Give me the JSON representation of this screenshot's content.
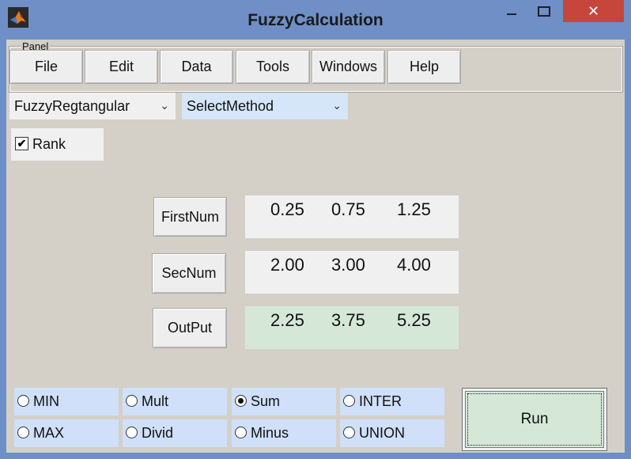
{
  "window": {
    "title": "FuzzyCalculation",
    "close_glyph": "✕"
  },
  "panel": {
    "label": "Panel"
  },
  "menu": [
    {
      "label": "File"
    },
    {
      "label": "Edit"
    },
    {
      "label": "Data"
    },
    {
      "label": "Tools"
    },
    {
      "label": "Windows"
    },
    {
      "label": "Help"
    }
  ],
  "selects": {
    "fuzzy_type": {
      "value": "FuzzyRegtangular",
      "bg": "#f0f0f0"
    },
    "method": {
      "value": "SelectMethod",
      "bg": "#d5e6f8"
    }
  },
  "rank": {
    "label": "Rank",
    "checked": true,
    "glyph": "✔"
  },
  "rows": [
    {
      "button": "FirstNum",
      "values": [
        "0.25",
        "0.75",
        "1.25"
      ]
    },
    {
      "button": "SecNum",
      "values": [
        "2.00",
        "3.00",
        "4.00"
      ]
    },
    {
      "button": "OutPut",
      "values": [
        "2.25",
        "3.75",
        "5.25"
      ]
    }
  ],
  "operations": [
    {
      "label": "MIN",
      "selected": false
    },
    {
      "label": "Mult",
      "selected": false
    },
    {
      "label": "Sum",
      "selected": true
    },
    {
      "label": "INTER",
      "selected": false
    },
    {
      "label": "MAX",
      "selected": false
    },
    {
      "label": "Divid",
      "selected": false
    },
    {
      "label": "Minus",
      "selected": false
    },
    {
      "label": "UNION",
      "selected": false
    }
  ],
  "run": {
    "label": "Run"
  },
  "colors": {
    "titlebar": "#6f8fc6",
    "close": "#c7463c",
    "panel_bg": "#d4d0c8",
    "output_bg": "#d5e8d8",
    "radio_bg": "#cfe0f8"
  }
}
